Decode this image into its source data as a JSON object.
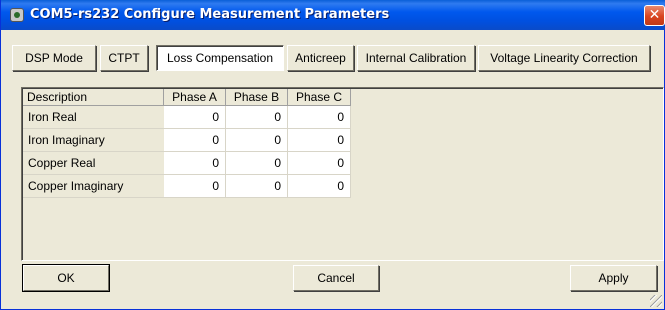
{
  "window": {
    "title": "COM5-rs232 Configure Measurement Parameters",
    "app_icon": "meter-icon",
    "close_icon": "close-icon",
    "close_glyph": "✕"
  },
  "tabs": [
    {
      "label": "DSP Mode",
      "active": false
    },
    {
      "label": "CTPT",
      "active": false
    },
    {
      "label": "Loss Compensation",
      "active": true
    },
    {
      "label": "Anticreep",
      "active": false
    },
    {
      "label": "Internal Calibration",
      "active": false
    },
    {
      "label": "Voltage Linearity Correction",
      "active": false
    }
  ],
  "grid": {
    "columns": [
      "Description",
      "Phase A",
      "Phase B",
      "Phase C"
    ],
    "rows": [
      {
        "label": "Iron Real",
        "values": [
          "0",
          "0",
          "0"
        ]
      },
      {
        "label": "Iron Imaginary",
        "values": [
          "0",
          "0",
          "0"
        ]
      },
      {
        "label": "Copper Real",
        "values": [
          "0",
          "0",
          "0"
        ]
      },
      {
        "label": "Copper Imaginary",
        "values": [
          "0",
          "0",
          "0"
        ]
      }
    ]
  },
  "buttons": {
    "ok": "OK",
    "cancel": "Cancel",
    "apply": "Apply"
  },
  "colors": {
    "title_bar": "#0054e3",
    "dialog_face": "#ece9d8",
    "close_button": "#d9441f"
  }
}
